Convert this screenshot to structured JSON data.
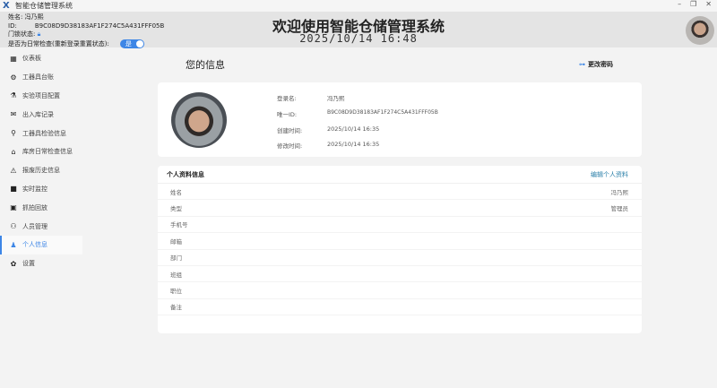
{
  "app": {
    "title": "智能仓储管理系统",
    "logo": "X"
  },
  "window": {
    "minimize": "–",
    "restore": "❐",
    "close": "✕"
  },
  "header": {
    "name_label": "姓名:",
    "name": "冯乃熙",
    "id_label": "ID:",
    "id": "B9C08D9D38183AF1F274C5A431FFF05B",
    "door_label": "门锁状态:",
    "door_icon": "lock-icon",
    "daily_label": "是否为日常检查(重新登录重置状态):",
    "daily_toggle": "是",
    "daily_on": true,
    "title": "欢迎使用智能仓储管理系统",
    "datetime": "2025/10/14 16:48"
  },
  "sidebar": {
    "items": [
      {
        "label": "仪表板",
        "icon": "▦"
      },
      {
        "label": "工器具台账",
        "icon": "⚙"
      },
      {
        "label": "实验项目配置",
        "icon": "⚗"
      },
      {
        "label": "出入库记录",
        "icon": "✉"
      },
      {
        "label": "工器具检验信息",
        "icon": "⚲"
      },
      {
        "label": "库房日常检查信息",
        "icon": "⌂"
      },
      {
        "label": "报废历史信息",
        "icon": "⚠"
      },
      {
        "label": "实时监控",
        "icon": "■"
      },
      {
        "label": "抓拍回放",
        "icon": "▣"
      },
      {
        "label": "人员管理",
        "icon": "⚇"
      },
      {
        "label": "个人信息",
        "icon": "♟"
      },
      {
        "label": "设置",
        "icon": "✿"
      }
    ],
    "active": 10
  },
  "page": {
    "title": "您的信息",
    "change_password": "更改密码",
    "key_icon": "⊶"
  },
  "profile": {
    "login_label": "登录名:",
    "login": "冯乃熙",
    "uid_label": "唯一ID:",
    "uid": "B9C08D9D38183AF1F274C5A431FFF05B",
    "created_label": "创建时间:",
    "created": "2025/10/14  16:35",
    "modified_label": "修改时间:",
    "modified": "2025/10/14  16:35"
  },
  "details": {
    "title": "个人资料信息",
    "edit": "编辑个人资料",
    "rows": [
      {
        "label": "姓名",
        "value": "冯乃熙"
      },
      {
        "label": "类型",
        "value": "管理员"
      },
      {
        "label": "手机号",
        "value": ""
      },
      {
        "label": "邮箱",
        "value": ""
      },
      {
        "label": "部门",
        "value": ""
      },
      {
        "label": "班组",
        "value": ""
      },
      {
        "label": "职位",
        "value": ""
      },
      {
        "label": "备注",
        "value": ""
      }
    ]
  }
}
